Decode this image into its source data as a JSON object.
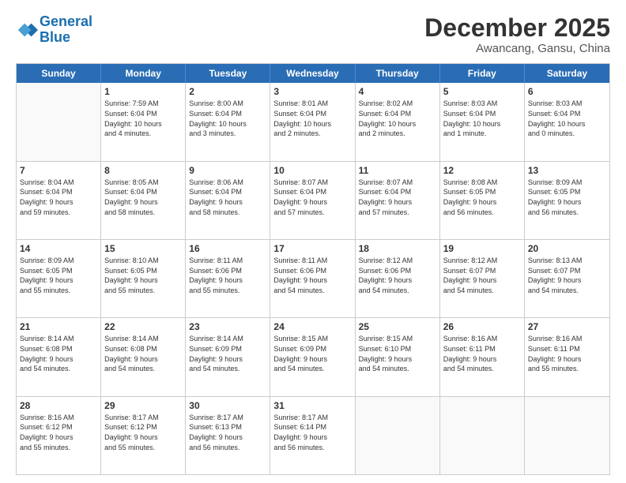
{
  "logo": {
    "line1": "General",
    "line2": "Blue"
  },
  "title": "December 2025",
  "subtitle": "Awancang, Gansu, China",
  "header_days": [
    "Sunday",
    "Monday",
    "Tuesday",
    "Wednesday",
    "Thursday",
    "Friday",
    "Saturday"
  ],
  "weeks": [
    [
      {
        "day": "",
        "info": ""
      },
      {
        "day": "1",
        "info": "Sunrise: 7:59 AM\nSunset: 6:04 PM\nDaylight: 10 hours\nand 4 minutes."
      },
      {
        "day": "2",
        "info": "Sunrise: 8:00 AM\nSunset: 6:04 PM\nDaylight: 10 hours\nand 3 minutes."
      },
      {
        "day": "3",
        "info": "Sunrise: 8:01 AM\nSunset: 6:04 PM\nDaylight: 10 hours\nand 2 minutes."
      },
      {
        "day": "4",
        "info": "Sunrise: 8:02 AM\nSunset: 6:04 PM\nDaylight: 10 hours\nand 2 minutes."
      },
      {
        "day": "5",
        "info": "Sunrise: 8:03 AM\nSunset: 6:04 PM\nDaylight: 10 hours\nand 1 minute."
      },
      {
        "day": "6",
        "info": "Sunrise: 8:03 AM\nSunset: 6:04 PM\nDaylight: 10 hours\nand 0 minutes."
      }
    ],
    [
      {
        "day": "7",
        "info": "Sunrise: 8:04 AM\nSunset: 6:04 PM\nDaylight: 9 hours\nand 59 minutes."
      },
      {
        "day": "8",
        "info": "Sunrise: 8:05 AM\nSunset: 6:04 PM\nDaylight: 9 hours\nand 58 minutes."
      },
      {
        "day": "9",
        "info": "Sunrise: 8:06 AM\nSunset: 6:04 PM\nDaylight: 9 hours\nand 58 minutes."
      },
      {
        "day": "10",
        "info": "Sunrise: 8:07 AM\nSunset: 6:04 PM\nDaylight: 9 hours\nand 57 minutes."
      },
      {
        "day": "11",
        "info": "Sunrise: 8:07 AM\nSunset: 6:04 PM\nDaylight: 9 hours\nand 57 minutes."
      },
      {
        "day": "12",
        "info": "Sunrise: 8:08 AM\nSunset: 6:05 PM\nDaylight: 9 hours\nand 56 minutes."
      },
      {
        "day": "13",
        "info": "Sunrise: 8:09 AM\nSunset: 6:05 PM\nDaylight: 9 hours\nand 56 minutes."
      }
    ],
    [
      {
        "day": "14",
        "info": "Sunrise: 8:09 AM\nSunset: 6:05 PM\nDaylight: 9 hours\nand 55 minutes."
      },
      {
        "day": "15",
        "info": "Sunrise: 8:10 AM\nSunset: 6:05 PM\nDaylight: 9 hours\nand 55 minutes."
      },
      {
        "day": "16",
        "info": "Sunrise: 8:11 AM\nSunset: 6:06 PM\nDaylight: 9 hours\nand 55 minutes."
      },
      {
        "day": "17",
        "info": "Sunrise: 8:11 AM\nSunset: 6:06 PM\nDaylight: 9 hours\nand 54 minutes."
      },
      {
        "day": "18",
        "info": "Sunrise: 8:12 AM\nSunset: 6:06 PM\nDaylight: 9 hours\nand 54 minutes."
      },
      {
        "day": "19",
        "info": "Sunrise: 8:12 AM\nSunset: 6:07 PM\nDaylight: 9 hours\nand 54 minutes."
      },
      {
        "day": "20",
        "info": "Sunrise: 8:13 AM\nSunset: 6:07 PM\nDaylight: 9 hours\nand 54 minutes."
      }
    ],
    [
      {
        "day": "21",
        "info": "Sunrise: 8:14 AM\nSunset: 6:08 PM\nDaylight: 9 hours\nand 54 minutes."
      },
      {
        "day": "22",
        "info": "Sunrise: 8:14 AM\nSunset: 6:08 PM\nDaylight: 9 hours\nand 54 minutes."
      },
      {
        "day": "23",
        "info": "Sunrise: 8:14 AM\nSunset: 6:09 PM\nDaylight: 9 hours\nand 54 minutes."
      },
      {
        "day": "24",
        "info": "Sunrise: 8:15 AM\nSunset: 6:09 PM\nDaylight: 9 hours\nand 54 minutes."
      },
      {
        "day": "25",
        "info": "Sunrise: 8:15 AM\nSunset: 6:10 PM\nDaylight: 9 hours\nand 54 minutes."
      },
      {
        "day": "26",
        "info": "Sunrise: 8:16 AM\nSunset: 6:11 PM\nDaylight: 9 hours\nand 54 minutes."
      },
      {
        "day": "27",
        "info": "Sunrise: 8:16 AM\nSunset: 6:11 PM\nDaylight: 9 hours\nand 55 minutes."
      }
    ],
    [
      {
        "day": "28",
        "info": "Sunrise: 8:16 AM\nSunset: 6:12 PM\nDaylight: 9 hours\nand 55 minutes."
      },
      {
        "day": "29",
        "info": "Sunrise: 8:17 AM\nSunset: 6:12 PM\nDaylight: 9 hours\nand 55 minutes."
      },
      {
        "day": "30",
        "info": "Sunrise: 8:17 AM\nSunset: 6:13 PM\nDaylight: 9 hours\nand 56 minutes."
      },
      {
        "day": "31",
        "info": "Sunrise: 8:17 AM\nSunset: 6:14 PM\nDaylight: 9 hours\nand 56 minutes."
      },
      {
        "day": "",
        "info": ""
      },
      {
        "day": "",
        "info": ""
      },
      {
        "day": "",
        "info": ""
      }
    ]
  ]
}
